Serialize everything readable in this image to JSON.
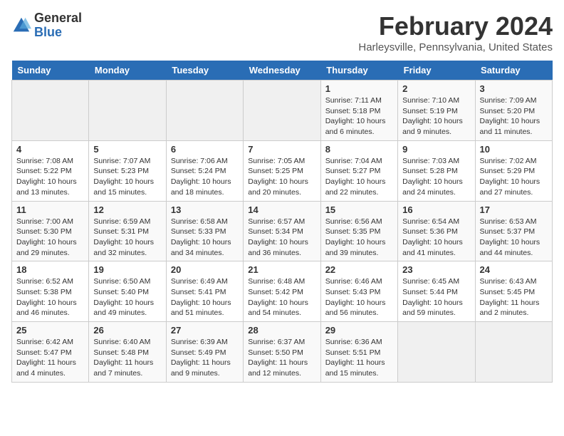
{
  "header": {
    "logo_line1": "General",
    "logo_line2": "Blue",
    "month_title": "February 2024",
    "location": "Harleysville, Pennsylvania, United States"
  },
  "days_of_week": [
    "Sunday",
    "Monday",
    "Tuesday",
    "Wednesday",
    "Thursday",
    "Friday",
    "Saturday"
  ],
  "weeks": [
    [
      {
        "day": "",
        "details": ""
      },
      {
        "day": "",
        "details": ""
      },
      {
        "day": "",
        "details": ""
      },
      {
        "day": "",
        "details": ""
      },
      {
        "day": "1",
        "details": "Sunrise: 7:11 AM\nSunset: 5:18 PM\nDaylight: 10 hours\nand 6 minutes."
      },
      {
        "day": "2",
        "details": "Sunrise: 7:10 AM\nSunset: 5:19 PM\nDaylight: 10 hours\nand 9 minutes."
      },
      {
        "day": "3",
        "details": "Sunrise: 7:09 AM\nSunset: 5:20 PM\nDaylight: 10 hours\nand 11 minutes."
      }
    ],
    [
      {
        "day": "4",
        "details": "Sunrise: 7:08 AM\nSunset: 5:22 PM\nDaylight: 10 hours\nand 13 minutes."
      },
      {
        "day": "5",
        "details": "Sunrise: 7:07 AM\nSunset: 5:23 PM\nDaylight: 10 hours\nand 15 minutes."
      },
      {
        "day": "6",
        "details": "Sunrise: 7:06 AM\nSunset: 5:24 PM\nDaylight: 10 hours\nand 18 minutes."
      },
      {
        "day": "7",
        "details": "Sunrise: 7:05 AM\nSunset: 5:25 PM\nDaylight: 10 hours\nand 20 minutes."
      },
      {
        "day": "8",
        "details": "Sunrise: 7:04 AM\nSunset: 5:27 PM\nDaylight: 10 hours\nand 22 minutes."
      },
      {
        "day": "9",
        "details": "Sunrise: 7:03 AM\nSunset: 5:28 PM\nDaylight: 10 hours\nand 24 minutes."
      },
      {
        "day": "10",
        "details": "Sunrise: 7:02 AM\nSunset: 5:29 PM\nDaylight: 10 hours\nand 27 minutes."
      }
    ],
    [
      {
        "day": "11",
        "details": "Sunrise: 7:00 AM\nSunset: 5:30 PM\nDaylight: 10 hours\nand 29 minutes."
      },
      {
        "day": "12",
        "details": "Sunrise: 6:59 AM\nSunset: 5:31 PM\nDaylight: 10 hours\nand 32 minutes."
      },
      {
        "day": "13",
        "details": "Sunrise: 6:58 AM\nSunset: 5:33 PM\nDaylight: 10 hours\nand 34 minutes."
      },
      {
        "day": "14",
        "details": "Sunrise: 6:57 AM\nSunset: 5:34 PM\nDaylight: 10 hours\nand 36 minutes."
      },
      {
        "day": "15",
        "details": "Sunrise: 6:56 AM\nSunset: 5:35 PM\nDaylight: 10 hours\nand 39 minutes."
      },
      {
        "day": "16",
        "details": "Sunrise: 6:54 AM\nSunset: 5:36 PM\nDaylight: 10 hours\nand 41 minutes."
      },
      {
        "day": "17",
        "details": "Sunrise: 6:53 AM\nSunset: 5:37 PM\nDaylight: 10 hours\nand 44 minutes."
      }
    ],
    [
      {
        "day": "18",
        "details": "Sunrise: 6:52 AM\nSunset: 5:38 PM\nDaylight: 10 hours\nand 46 minutes."
      },
      {
        "day": "19",
        "details": "Sunrise: 6:50 AM\nSunset: 5:40 PM\nDaylight: 10 hours\nand 49 minutes."
      },
      {
        "day": "20",
        "details": "Sunrise: 6:49 AM\nSunset: 5:41 PM\nDaylight: 10 hours\nand 51 minutes."
      },
      {
        "day": "21",
        "details": "Sunrise: 6:48 AM\nSunset: 5:42 PM\nDaylight: 10 hours\nand 54 minutes."
      },
      {
        "day": "22",
        "details": "Sunrise: 6:46 AM\nSunset: 5:43 PM\nDaylight: 10 hours\nand 56 minutes."
      },
      {
        "day": "23",
        "details": "Sunrise: 6:45 AM\nSunset: 5:44 PM\nDaylight: 10 hours\nand 59 minutes."
      },
      {
        "day": "24",
        "details": "Sunrise: 6:43 AM\nSunset: 5:45 PM\nDaylight: 11 hours\nand 2 minutes."
      }
    ],
    [
      {
        "day": "25",
        "details": "Sunrise: 6:42 AM\nSunset: 5:47 PM\nDaylight: 11 hours\nand 4 minutes."
      },
      {
        "day": "26",
        "details": "Sunrise: 6:40 AM\nSunset: 5:48 PM\nDaylight: 11 hours\nand 7 minutes."
      },
      {
        "day": "27",
        "details": "Sunrise: 6:39 AM\nSunset: 5:49 PM\nDaylight: 11 hours\nand 9 minutes."
      },
      {
        "day": "28",
        "details": "Sunrise: 6:37 AM\nSunset: 5:50 PM\nDaylight: 11 hours\nand 12 minutes."
      },
      {
        "day": "29",
        "details": "Sunrise: 6:36 AM\nSunset: 5:51 PM\nDaylight: 11 hours\nand 15 minutes."
      },
      {
        "day": "",
        "details": ""
      },
      {
        "day": "",
        "details": ""
      }
    ]
  ]
}
